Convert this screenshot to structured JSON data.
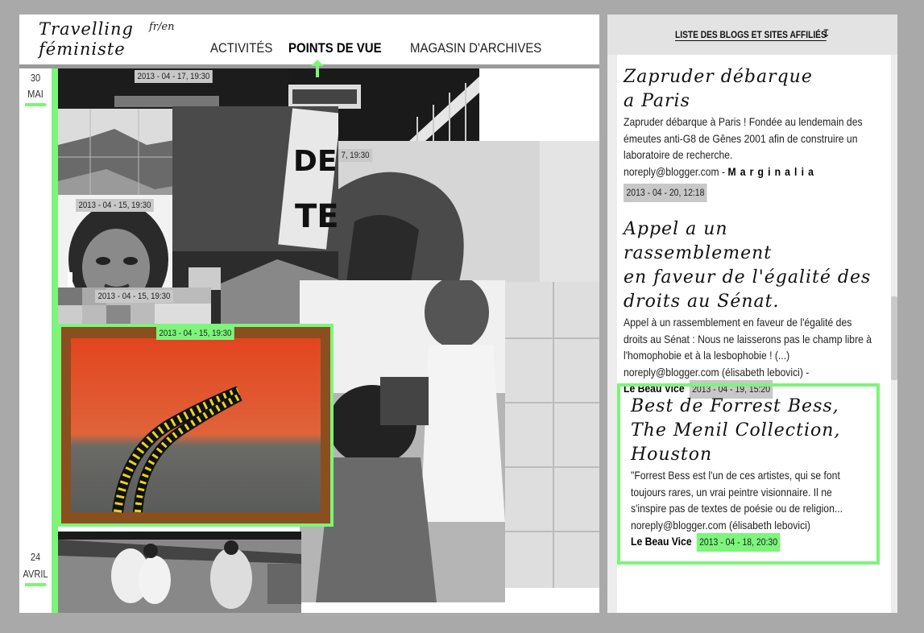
{
  "header": {
    "logo_line1": "Travelling",
    "logo_line2": "féministe",
    "lang": "fr/en",
    "nav": [
      {
        "label": "ACTIVITÉS",
        "active": false
      },
      {
        "label": "POINTS DE VUE",
        "active": true
      },
      {
        "label": "MAGASIN D'ARCHIVES",
        "active": false
      }
    ]
  },
  "timeline": {
    "top_date": {
      "day": "30",
      "month": "MAI"
    },
    "bottom_date": {
      "day": "24",
      "month": "AVRIL"
    },
    "accent_color": "#7cf57a"
  },
  "tiles": [
    {
      "timestamp": "2013 - 04 - 17, 19:30"
    },
    {
      "timestamp": "2013 - 04 - 15, 19:30"
    },
    {
      "timestamp": "2013 - 04 - 15, 19:30"
    },
    {
      "timestamp": "2013 - 04 - 15, 19:30"
    },
    {
      "timestamp": "7, 19:30"
    }
  ],
  "sidebar": {
    "blogs_link": "LISTE DES BLOGS  ET SITES AFFILIÉS",
    "entries": [
      {
        "title_line1": "Zapruder débarque",
        "title_line2": "a Paris",
        "body": "Zapruder débarque à Paris ! Fondée au lendemain des émeutes anti-G8 de Gênes 2001 afin de construire un laboratoire de recherche.",
        "source": "noreply@blogger.com -",
        "author": "M a r g i n a l i a",
        "timestamp": "2013 - 04 - 20, 12:18"
      },
      {
        "title_line1": "Appel a un rassemblement",
        "title_line2": "en faveur de l'égalité des",
        "title_line3": "droits au Sénat.",
        "body": "Appel à un rassemblement en faveur de l'égalité des droits au Sénat : Nous ne laisserons pas le champ libre à l'homophobie et à la lesbophobie ! (...)",
        "source": "noreply@blogger.com (élisabeth lebovici) -",
        "author": "Le Beau Vice",
        "timestamp": "2013 - 04 - 19, 15:20"
      },
      {
        "title_line1": "Best de Forrest Bess,",
        "title_line2": "The Menil Collection,",
        "title_line3": "Houston",
        "body": "\"Forrest Bess est l'un de ces artistes, qui se font toujours rares, un vrai peintre visionnaire. Il ne s'inspire pas de textes de poésie ou de religion...",
        "source": "noreply@blogger.com (élisabeth lebovici)",
        "author": "Le Beau Vice",
        "timestamp": "2013 - 04 - 18, 20:30"
      }
    ]
  }
}
